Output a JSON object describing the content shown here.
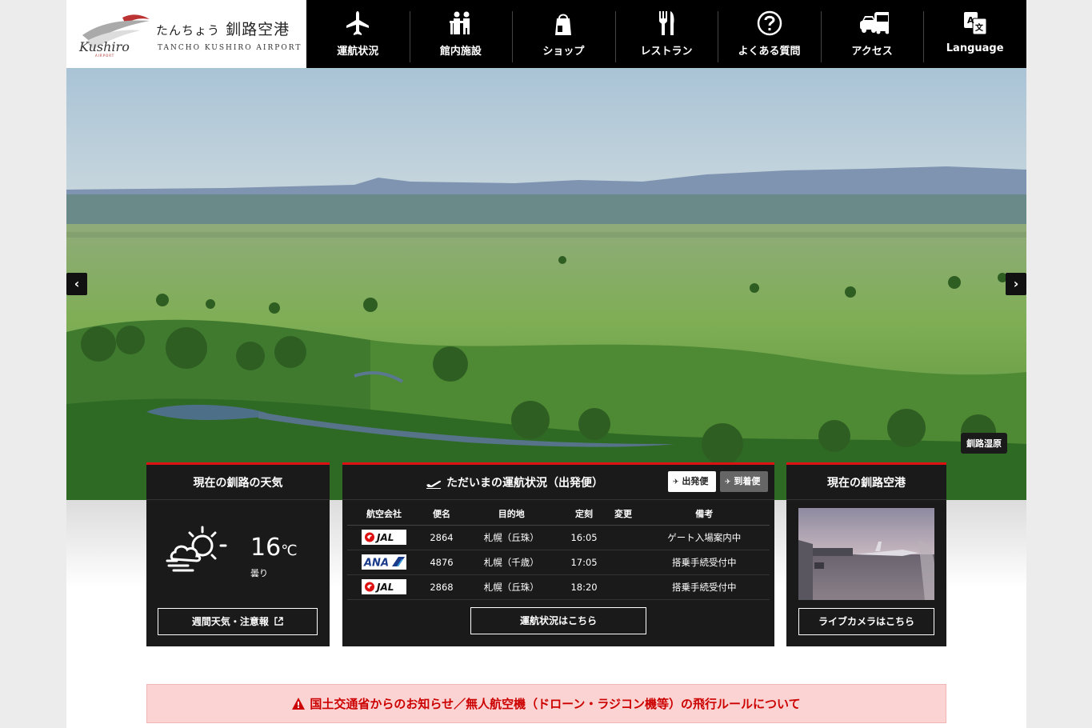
{
  "header": {
    "logo_jp_prefix": "たんちょう",
    "logo_jp_name": "釧路空港",
    "logo_en": "TANCHO KUSHIRO AIRPORT",
    "nav": [
      {
        "label": "運航状況",
        "icon": "airplane-icon"
      },
      {
        "label": "館内施設",
        "icon": "facility-icon"
      },
      {
        "label": "ショップ",
        "icon": "shopping-bag-icon"
      },
      {
        "label": "レストラン",
        "icon": "fork-knife-icon"
      },
      {
        "label": "よくある質問",
        "icon": "question-icon"
      },
      {
        "label": "アクセス",
        "icon": "car-bus-icon"
      },
      {
        "label": "Language",
        "icon": "translate-icon"
      }
    ]
  },
  "hero": {
    "caption": "釧路湿原",
    "prev_icon": "chevron-left-icon",
    "next_icon": "chevron-right-icon"
  },
  "weather": {
    "title": "現在の釧路の天気",
    "temperature": "16",
    "unit": "℃",
    "condition": "曇り",
    "button": "週間天気・注意報",
    "icon": "cloudy-sun-icon"
  },
  "flights": {
    "title": "ただいまの運航状況（出発便）",
    "toggle_departures": "出発便",
    "toggle_arrivals": "到着便",
    "columns": [
      "航空会社",
      "便名",
      "目的地",
      "定刻",
      "変更",
      "備考"
    ],
    "rows": [
      {
        "airline": "JAL",
        "flight": "2864",
        "destination": "札幌（丘珠）",
        "scheduled": "16:05",
        "changed": "",
        "remarks": "ゲート入場案内中"
      },
      {
        "airline": "ANA",
        "flight": "4876",
        "destination": "札幌（千歳）",
        "scheduled": "17:05",
        "changed": "",
        "remarks": "搭乗手続受付中"
      },
      {
        "airline": "JAL",
        "flight": "2868",
        "destination": "札幌（丘珠）",
        "scheduled": "18:20",
        "changed": "",
        "remarks": "搭乗手続受付中"
      }
    ],
    "button": "運航状況はこちら"
  },
  "camera": {
    "title": "現在の釧路空港",
    "button": "ライブカメラはこちら"
  },
  "notice": {
    "text": "国土交通省からのお知らせ／無人航空機（ドローン・ラジコン機等）の飛行ルールについて"
  },
  "colors": {
    "accent": "#dd1111",
    "header_bg": "#000000",
    "panel_bg": "#1a1a1a",
    "notice_bg": "#fcd3d3",
    "notice_text": "#cc0000"
  }
}
